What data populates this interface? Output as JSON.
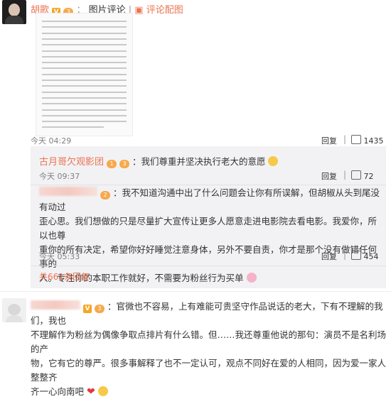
{
  "post": {
    "author": "胡歌",
    "v_badge": "V",
    "level_badge": "3",
    "source": "图片评论",
    "view_image_link": "评论配图",
    "time": "今天 04:29",
    "reply_label": "回复",
    "like_count": "1435"
  },
  "text_image_lines": [
    "周迷 都是我不能接受的 抄袭 这部电影",
    "对我很重要 我也非常感谢大家对我的支",
    "持 可作为演员 我对这份职业的敬畏",
    "要长对电影艺术的尊重 我不希望我特殊",
    "的方式来制造噱头吸量 但对我来说最",
    "后也会完成的，因为我相信正能量会被",
    "传递出去。我现在能做的就是将这个感",
    "想告诉大家 我希望我们都能理解我的",
    "立场 我也会和大家一样继续支持这部",
    "作品。让我们一起努力，为电影加油吧",
    "我们是相信电影是可以给大家带来的好",
    "影响的 我也相信我不会让大家失望的",
    "希望大家都能理解 谢谢大家 支持我",
    "时候给我所以下面这一行字的说明 我",
    "们一起为中国电影加油 我会继续努力",
    "希望你们也能继续支持 我们下部作品",
    "再见 感谢大家的理解 祝大家身体健康",
    "对不起 让大家担心了",
    "我们一起加油吧，未来的路还很长"
  ],
  "replies": [
    {
      "author": "古月哥欠观影团",
      "text": "：我们尊重并坚决执行老大的意愿",
      "time": "今天 09:37",
      "reply_label": "回复",
      "like_count": "72"
    },
    {
      "author": "",
      "lines": [
        "：我不知道沟通中出了什么问题会让你有所误解，但胡椒从头到尾没有动过",
        "歪心思。我们想做的只是尽量扩大宣传让更多人愿意走进电影院去看电影。我爱你，所以也尊",
        "重你的所有决定，希望你好好睡觉注意身体，另外不要自责，你才是那个没有做错任何事的",
        "人。专注你的本职工作就好，不需要为粉丝行为买单"
      ],
      "time": "今天 05:33",
      "reply_label": "回复",
      "like_count": "454"
    }
  ],
  "more_replies": "共661条回复",
  "comment3": {
    "author": "",
    "lines": [
      "：官微也不容易，上有难能可贵坚守作品说话的老大，下有不理解的我们，我也",
      "不理解作为粉丝为偶像争取点排片有什么错。但……我还尊重他说的那句：演员不是名利场的产",
      "物，它有它的尊严。很多事解释了也不一定认可，观点不同好在爱的人相同，因为爱一家人整整齐",
      "齐一心向南吧"
    ]
  },
  "colors": {
    "name_orange": "#eb7350",
    "reply_bg": "#f2f2f5",
    "badge": "#f6a623"
  }
}
